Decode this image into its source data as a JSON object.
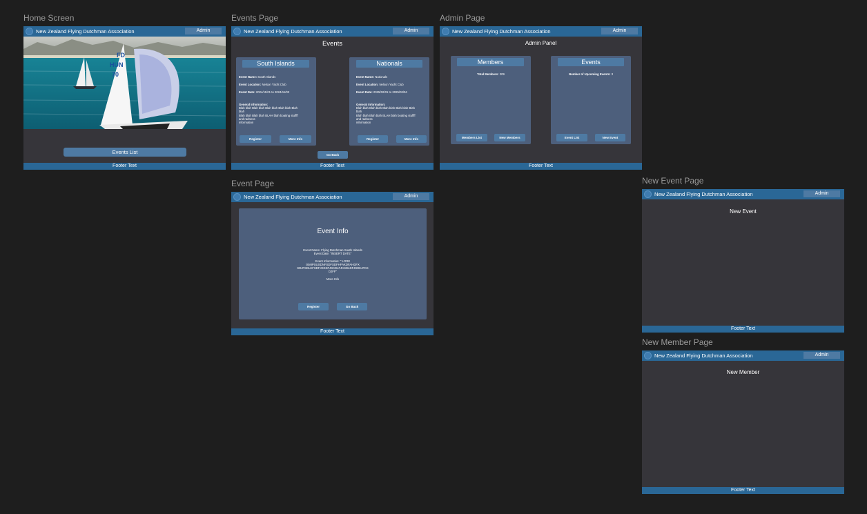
{
  "app": {
    "site_title": "New Zealand Flying Dutchman Association",
    "admin_label": "Admin",
    "footer_text": "Footer Text"
  },
  "labels": {
    "home": "Home Screen",
    "events": "Events Page",
    "admin": "Admin Page",
    "event": "Event Page",
    "new_event": "New Event Page",
    "new_member": "New Member Page"
  },
  "home": {
    "events_list_button": "Events List",
    "hero_sail_numbers": [
      "FD",
      "HUN",
      "70"
    ]
  },
  "events_page": {
    "title": "Events",
    "go_back": "Go Back",
    "cards": [
      {
        "heading": "South Islands",
        "name_label": "Event Name:",
        "name": "South Islands",
        "location_label": "Event Location:",
        "location": "Nelson Yacht Club",
        "date_label": "Event Date:",
        "date": "2024/11/01 to 2024/11/03",
        "info_label": "General Information:",
        "info_lines": [
          "Blah blah Blah blah Blah blah Blah blah Blah",
          "blah",
          "Blah blah Blah blah BLAH blah boating stuffff",
          "and radness",
          "information"
        ],
        "register": "Register",
        "more_info": "More Info"
      },
      {
        "heading": "Nationals",
        "name_label": "Event Name:",
        "name": "Nationals",
        "location_label": "Event Location:",
        "location": "Nelson Yacht Club",
        "date_label": "Event Date:",
        "date": "2025/02/01 to 2025/02/04",
        "info_label": "General Information:",
        "info_lines": [
          "Blah blah Blah blah Blah blah Blah blah Blah",
          "blah",
          "Blah blah Blah blah BLAH blah boating stuffff",
          "and radness",
          "information"
        ],
        "register": "Register",
        "more_info": "More Info"
      }
    ]
  },
  "admin_page": {
    "title": "Admin Panel",
    "members": {
      "heading": "Members",
      "stat_label": "Total Members:",
      "stat_value": "209",
      "btn_list": "Members List",
      "btn_new": "New Members"
    },
    "events": {
      "heading": "Events",
      "stat_label": "Number of Upcoming Events:",
      "stat_value": "3",
      "btn_list": "Event List",
      "btn_new": "New Event"
    }
  },
  "event_page": {
    "title": "Event Info",
    "lines": [
      "Event Name: Flying Dutchman South Islands",
      "Event Date: \"INSERT DATE\"",
      "",
      "Event Information: \" LORE",
      "ISMIPSUSDNFSDFSDFHFAKDFAHDFX",
      "SDJFSDLKFSDFJKDSFJSKDLFJKSDLDFJSDKJFKS",
      "DJFF\"",
      "",
      "More Info"
    ],
    "register": "Register",
    "go_back": "Go Back"
  },
  "new_event_page": {
    "title": "New Event"
  },
  "new_member_page": {
    "title": "New Member"
  }
}
